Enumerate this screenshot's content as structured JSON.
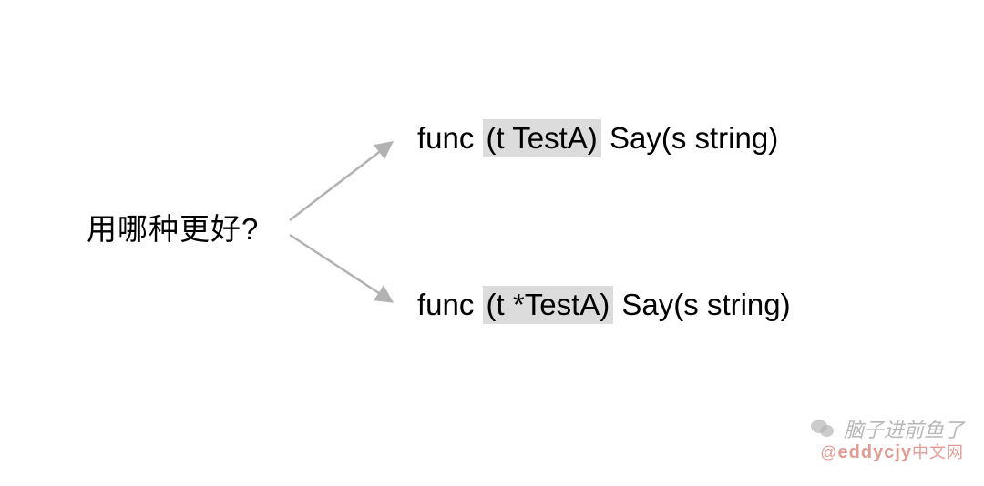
{
  "question": "用哪种更好?",
  "option1": {
    "prefix": "func ",
    "highlight": "(t TestA)",
    "suffix": " Say(s string)"
  },
  "option2": {
    "prefix": "func ",
    "highlight": "(t *TestA)",
    "suffix": " Say(s string)"
  },
  "watermark1": "脑子进前鱼了",
  "watermark2_at": "@",
  "watermark2_main": "eddycjy",
  "watermark2_suffix": "中文网"
}
